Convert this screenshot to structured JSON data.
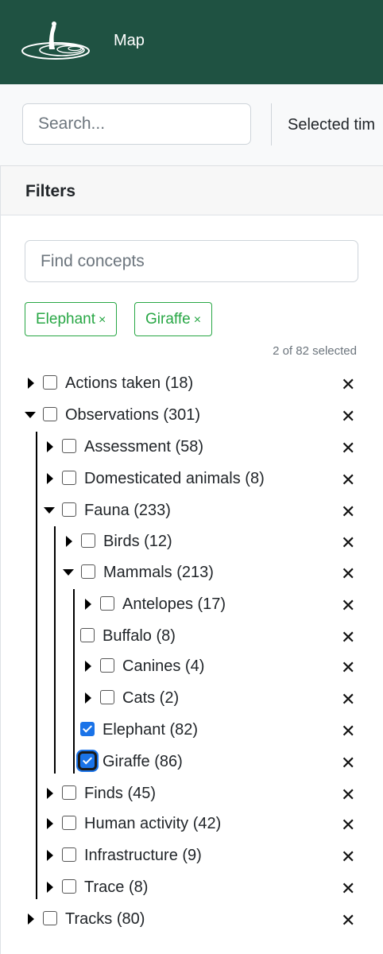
{
  "header": {
    "logo_icon": "meerkat-logo-icon",
    "nav_map": "Map",
    "bg_color": "#1f5242"
  },
  "toolbar": {
    "search_placeholder": "Search...",
    "selected_time_label": "Selected tim"
  },
  "filters": {
    "title": "Filters",
    "concept_placeholder": "Find concepts",
    "chips": [
      {
        "label": "Elephant",
        "remove": "×"
      },
      {
        "label": "Giraffe",
        "remove": "×"
      }
    ],
    "selected_count": "2 of 82 selected",
    "remove_glyph": "✕",
    "tree": [
      {
        "label": "Actions taken (18)",
        "expander": "closed",
        "checked": false
      },
      {
        "label": "Observations (301)",
        "expander": "open",
        "checked": false
      },
      {
        "label": "Assessment (58)",
        "expander": "closed",
        "checked": false
      },
      {
        "label": "Domesticated animals (8)",
        "expander": "closed",
        "checked": false
      },
      {
        "label": "Fauna (233)",
        "expander": "open",
        "checked": false
      },
      {
        "label": "Birds (12)",
        "expander": "closed",
        "checked": false
      },
      {
        "label": "Mammals (213)",
        "expander": "open",
        "checked": false
      },
      {
        "label": "Antelopes (17)",
        "expander": "closed",
        "checked": false
      },
      {
        "label": "Buffalo (8)",
        "expander": "none",
        "checked": false
      },
      {
        "label": "Canines (4)",
        "expander": "closed",
        "checked": false
      },
      {
        "label": "Cats (2)",
        "expander": "closed",
        "checked": false
      },
      {
        "label": "Elephant (82)",
        "expander": "none",
        "checked": true
      },
      {
        "label": "Giraffe (86)",
        "expander": "none",
        "checked": true
      },
      {
        "label": "Finds (45)",
        "expander": "closed",
        "checked": false
      },
      {
        "label": "Human activity (42)",
        "expander": "closed",
        "checked": false
      },
      {
        "label": "Infrastructure (9)",
        "expander": "closed",
        "checked": false
      },
      {
        "label": "Trace (8)",
        "expander": "closed",
        "checked": false
      },
      {
        "label": "Tracks (80)",
        "expander": "closed",
        "checked": false
      }
    ]
  },
  "colors": {
    "accent_green": "#28a745",
    "checkbox_blue": "#1a73e8"
  }
}
